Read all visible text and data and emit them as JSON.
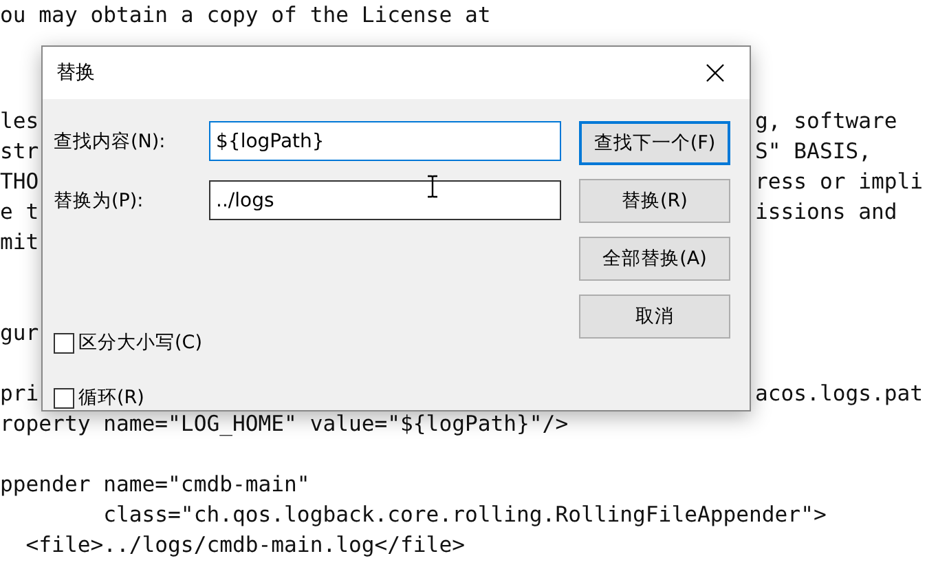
{
  "editor": {
    "blocks": [
      [
        {
          "left": "ou may obtain a copy of the License at"
        }
      ],
      [
        {
          "left": "les",
          "right": "g, software"
        },
        {
          "left": "str",
          "right": "S\" BASIS,"
        },
        {
          "left": "THO",
          "right": "ress or impli"
        },
        {
          "left": "e t",
          "right": "issions and"
        },
        {
          "left": "mit"
        }
      ],
      [
        {
          "left": "gur"
        }
      ],
      [
        {
          "left": "pri",
          "right": "acos.logs.pat"
        },
        {
          "left": "roperty name=\"LOG_HOME\" value=\"${logPath}\"/>"
        }
      ],
      [
        {
          "left": "ppender name=\"cmdb-main\""
        },
        {
          "left": "        class=\"ch.qos.logback.core.rolling.RollingFileAppender\">"
        },
        {
          "left": "  <file>../logs/cmdb-main.log</file>"
        }
      ]
    ]
  },
  "dialog": {
    "title": "替换",
    "fields": [
      {
        "label": "查找内容(N):",
        "value": "${logPath}",
        "focused": true
      },
      {
        "label": "替换为(P):",
        "value": "../logs",
        "focused": false
      }
    ],
    "buttons": [
      {
        "label": "查找下一个(F)",
        "default": true
      },
      {
        "label": "替换(R)",
        "default": false
      },
      {
        "label": "全部替换(A)",
        "default": false
      },
      {
        "label": "取消",
        "default": false
      }
    ],
    "checkboxes": [
      {
        "label": "区分大小写(C)",
        "checked": false
      },
      {
        "label": "循环(R)",
        "checked": false
      }
    ]
  }
}
